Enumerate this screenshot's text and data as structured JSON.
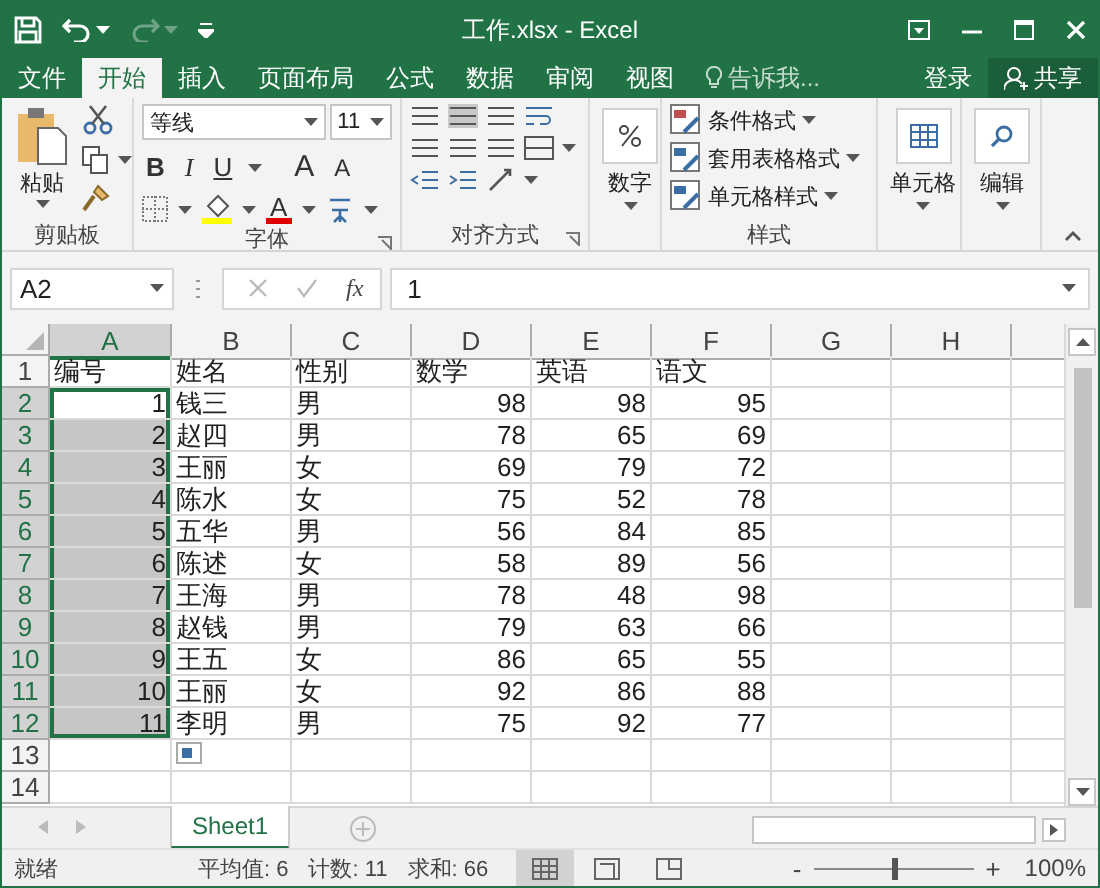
{
  "window": {
    "title": "工作.xlsx - Excel"
  },
  "quick_access": [
    {
      "kind": "save",
      "disabled": false
    },
    {
      "kind": "undo",
      "disabled": false
    },
    {
      "kind": "redo",
      "disabled": true
    },
    {
      "kind": "customize",
      "disabled": false
    }
  ],
  "ribbon_tabs": [
    {
      "label": "文件",
      "selected": false
    },
    {
      "label": "开始",
      "selected": true
    },
    {
      "label": "插入",
      "selected": false
    },
    {
      "label": "页面布局",
      "selected": false
    },
    {
      "label": "公式",
      "selected": false
    },
    {
      "label": "数据",
      "selected": false
    },
    {
      "label": "审阅",
      "selected": false
    },
    {
      "label": "视图",
      "selected": false
    }
  ],
  "tell_me": {
    "placeholder": "告诉我..."
  },
  "sign_in": "登录",
  "share": "共享",
  "clipboard": {
    "paste": "粘贴",
    "label": "剪贴板"
  },
  "font": {
    "name": "等线",
    "size": "11",
    "bold": "B",
    "italic": "I",
    "underline": "U",
    "grow": "A",
    "shrink": "A",
    "font_letter": "A",
    "label": "字体"
  },
  "alignment": {
    "label": "对齐方式"
  },
  "number": {
    "button": "数字"
  },
  "styles": {
    "items": [
      "条件格式",
      "套用表格格式",
      "单元格样式"
    ],
    "label": "样式"
  },
  "cells": {
    "button": "单元格"
  },
  "editing": {
    "button": "编辑"
  },
  "formula_bar": {
    "name_box": "A2",
    "function": "fx",
    "value": "1"
  },
  "sheet": {
    "columns": [
      {
        "label": "A",
        "selected": true
      },
      {
        "label": "B",
        "selected": false
      },
      {
        "label": "C",
        "selected": false
      },
      {
        "label": "D",
        "selected": false
      },
      {
        "label": "E",
        "selected": false
      },
      {
        "label": "F",
        "selected": false
      },
      {
        "label": "G",
        "selected": false
      },
      {
        "label": "H",
        "selected": false
      }
    ],
    "rows": [
      {
        "header": "1",
        "selected": false,
        "cells": [
          "编号",
          "姓名",
          "性别",
          "数学",
          "英语",
          "语文"
        ]
      },
      {
        "header": "2",
        "selected": true,
        "cells": [
          "1",
          "钱三",
          "男",
          "98",
          "98",
          "95"
        ]
      },
      {
        "header": "3",
        "selected": true,
        "cells": [
          "2",
          "赵四",
          "男",
          "78",
          "65",
          "69"
        ]
      },
      {
        "header": "4",
        "selected": true,
        "cells": [
          "3",
          "王丽",
          "女",
          "69",
          "79",
          "72"
        ]
      },
      {
        "header": "5",
        "selected": true,
        "cells": [
          "4",
          "陈水",
          "女",
          "75",
          "52",
          "78"
        ]
      },
      {
        "header": "6",
        "selected": true,
        "cells": [
          "5",
          "五华",
          "男",
          "56",
          "84",
          "85"
        ]
      },
      {
        "header": "7",
        "selected": true,
        "cells": [
          "6",
          "陈述",
          "女",
          "58",
          "89",
          "56"
        ]
      },
      {
        "header": "8",
        "selected": true,
        "cells": [
          "7",
          "王海",
          "男",
          "78",
          "48",
          "98"
        ]
      },
      {
        "header": "9",
        "selected": true,
        "cells": [
          "8",
          "赵钱",
          "男",
          "79",
          "63",
          "66"
        ]
      },
      {
        "header": "10",
        "selected": true,
        "cells": [
          "9",
          "王五",
          "女",
          "86",
          "65",
          "55"
        ]
      },
      {
        "header": "11",
        "selected": true,
        "cells": [
          "10",
          "王丽",
          "女",
          "92",
          "86",
          "88"
        ]
      },
      {
        "header": "12",
        "selected": true,
        "cells": [
          "11",
          "李明",
          "男",
          "75",
          "92",
          "77"
        ]
      },
      {
        "header": "13",
        "selected": false
      },
      {
        "header": "14",
        "selected": false
      }
    ]
  },
  "sheet_tabs": [
    {
      "label": "Sheet1",
      "selected": true
    }
  ],
  "status_bar": {
    "state": "就绪",
    "average": "平均值: 6",
    "count": "计数: 11",
    "sum": "求和: 66",
    "views": [
      {
        "kind": "normal",
        "selected": true
      },
      {
        "kind": "page_layout",
        "selected": false
      },
      {
        "kind": "page_break",
        "selected": false
      }
    ],
    "zoom_out": "-",
    "zoom_in": "+",
    "zoom": {
      "level": 0.5
    },
    "zoom_reading": "100%"
  }
}
